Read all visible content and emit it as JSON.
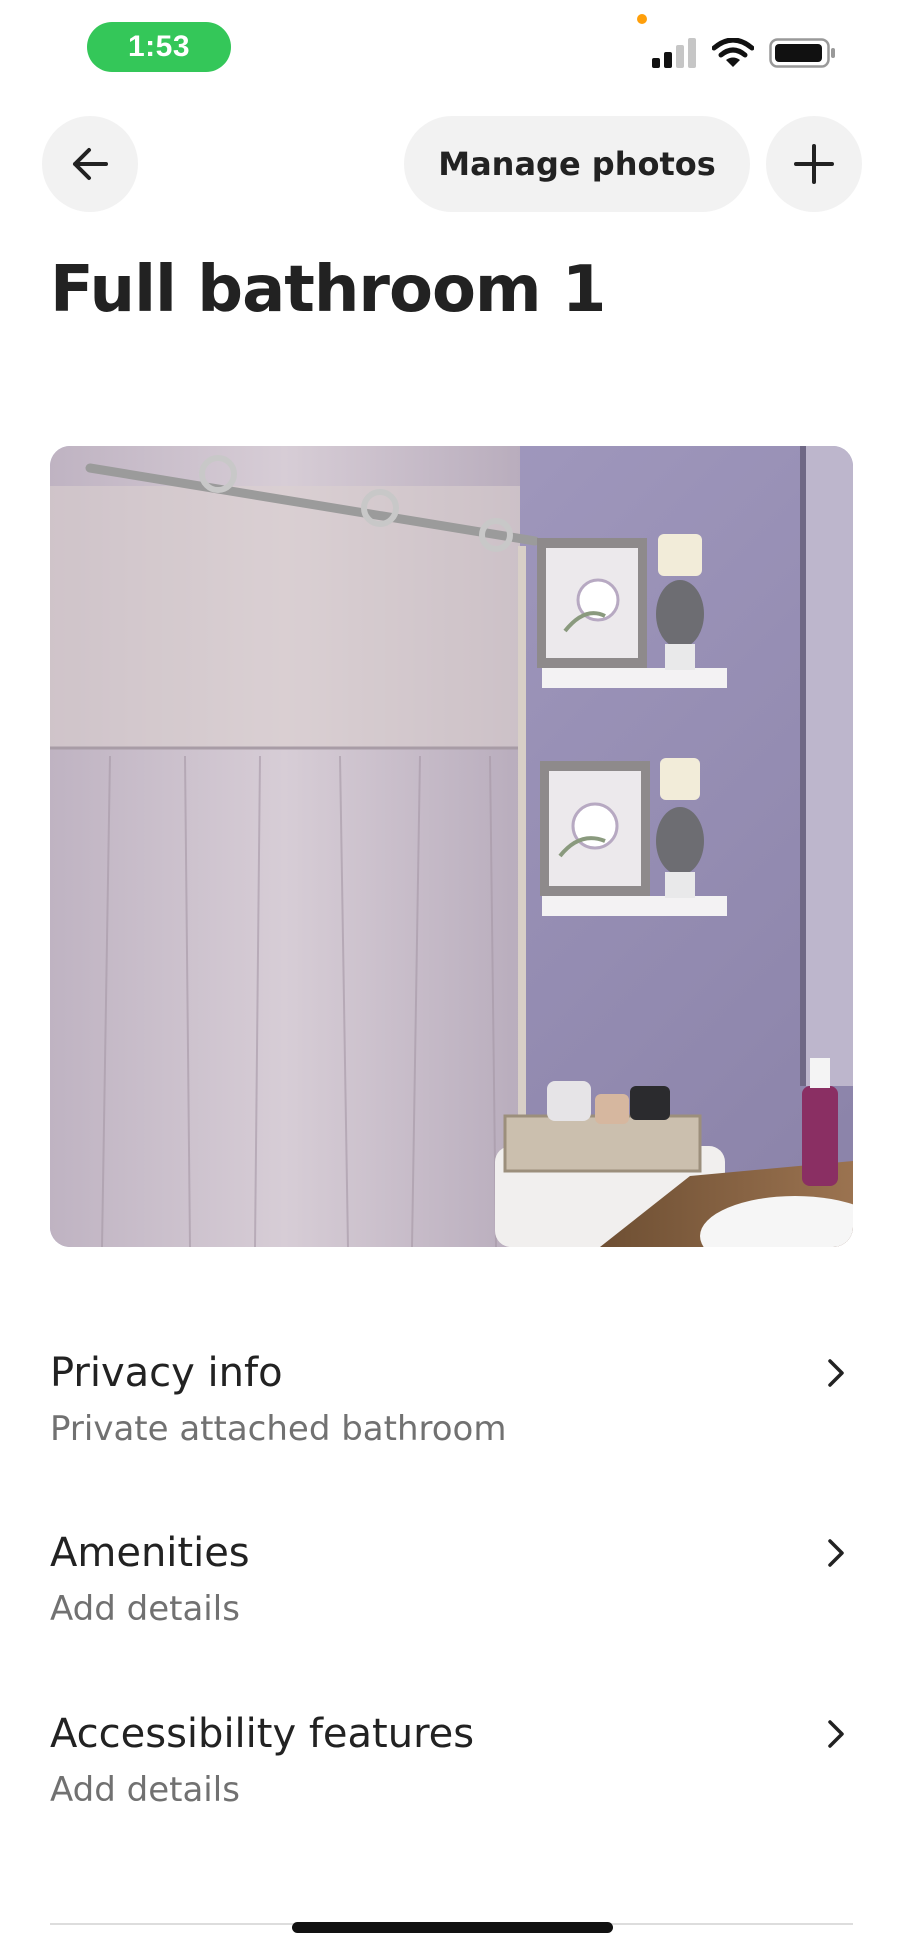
{
  "status_bar": {
    "time": "1:53",
    "colors": {
      "time_pill": "#34c759",
      "privacy_dot": "#ff9f0a"
    },
    "icons": [
      "signal-icon",
      "wifi-icon",
      "battery-icon"
    ]
  },
  "header": {
    "back_icon": "arrow-left-icon",
    "manage_photos_label": "Manage photos",
    "add_icon": "plus-icon"
  },
  "page": {
    "title": "Full bathroom 1"
  },
  "photo": {
    "alt": "Bathroom photo"
  },
  "rows": [
    {
      "title": "Privacy info",
      "subtitle": "Private attached bathroom"
    },
    {
      "title": "Amenities",
      "subtitle": "Add details"
    },
    {
      "title": "Accessibility features",
      "subtitle": "Add details"
    }
  ]
}
